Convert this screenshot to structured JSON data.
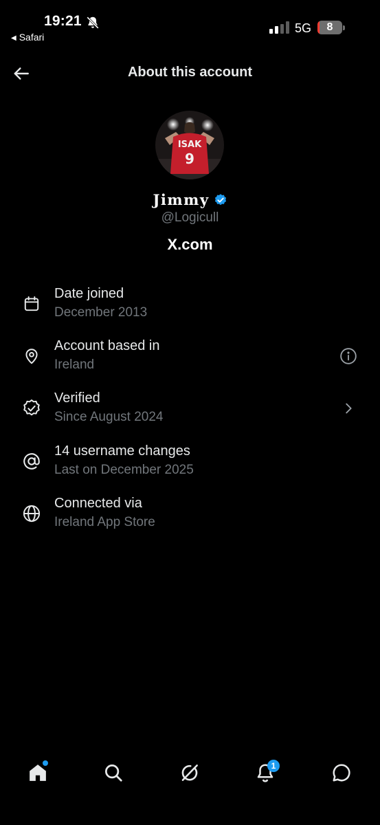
{
  "status_bar": {
    "time": "19:21",
    "back_app": "Safari",
    "network": "5G",
    "battery": "8",
    "battery_level": 0.08,
    "icons": [
      "bell-slash-icon",
      "signal-icon",
      "battery-icon"
    ]
  },
  "header": {
    "title": "About this account",
    "back_icon": "arrow-left-icon"
  },
  "profile": {
    "display_name": "Jimmy",
    "handle": "@Logicull",
    "site": "X.com",
    "avatar_jersey_name": "ISAK",
    "avatar_jersey_number": "9",
    "verified_color": "#1d9bf0"
  },
  "info": [
    {
      "label": "Date joined",
      "sub": "December 2013",
      "icon": "calendar-icon"
    },
    {
      "label": "Account based in",
      "sub": "Ireland",
      "icon": "location-pin-icon",
      "trailing": "info-icon"
    },
    {
      "label": "Verified",
      "sub": "Since August 2024",
      "icon": "verified-badge-icon",
      "trailing": "chevron-right-icon"
    },
    {
      "label": "14 username changes",
      "sub": "Last on December 2025",
      "icon": "at-sign-icon"
    },
    {
      "label": "Connected via",
      "sub": "Ireland App Store",
      "icon": "globe-icon"
    }
  ],
  "bottom_nav": {
    "items": [
      "home-icon",
      "search-icon",
      "grok-icon",
      "notifications-icon",
      "messages-icon"
    ],
    "notifications_badge": "1"
  },
  "colors": {
    "background": "#000000",
    "text": "#e7e9ea",
    "secondary_text": "#71767b",
    "accent": "#1d9bf0"
  }
}
